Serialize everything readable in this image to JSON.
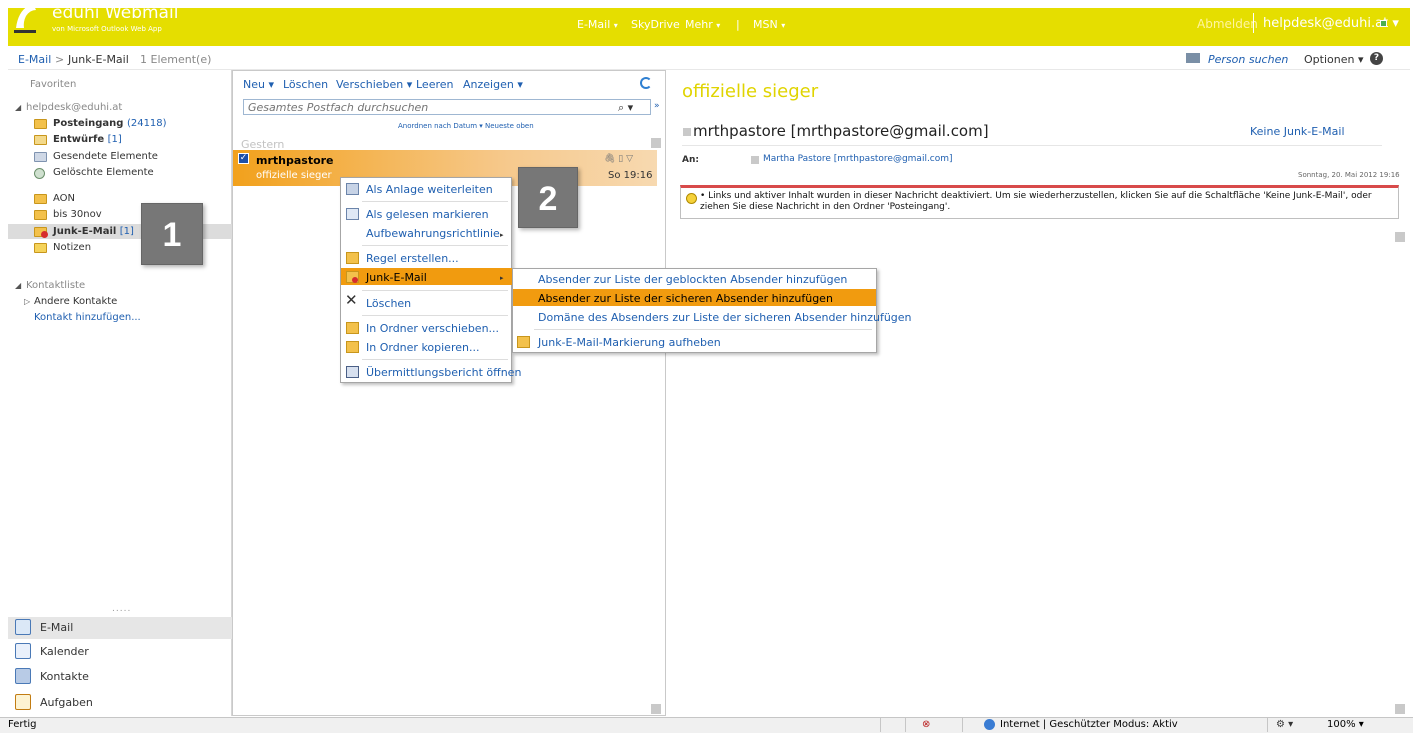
{
  "header": {
    "app_title": "eduhi Webmail",
    "app_subtitle": "von Microsoft Outlook Web App",
    "nav": [
      {
        "label": "E-Mail",
        "caret": "▾"
      },
      {
        "label": "SkyDrive",
        "caret": ""
      },
      {
        "label": "Mehr",
        "caret": "▾"
      },
      {
        "label": "|",
        "caret": ""
      },
      {
        "label": "MSN",
        "caret": "▾"
      }
    ],
    "logout": "Abmelden",
    "user": "helpdesk@eduhi.at ▾"
  },
  "breadcrumb": {
    "mail": "E-Mail",
    "separator": ">",
    "folder": "Junk-E-Mail",
    "count": "1 Element(e)",
    "person_search": "Person suchen",
    "options": "Optionen ▾",
    "help": "?"
  },
  "leftnav": {
    "favorites": "Favoriten",
    "account": "helpdesk@eduhi.at",
    "folders": [
      {
        "label": "Posteingang",
        "count": "(24118)",
        "bold": true
      },
      {
        "label": "Entwürfe",
        "count": "[1]",
        "bold": true
      },
      {
        "label": "Gesendete Elemente",
        "count": "",
        "bold": false
      },
      {
        "label": "Gelöschte Elemente",
        "count": "",
        "bold": false
      }
    ],
    "custom_folders": [
      {
        "label": "AON",
        "count": ""
      },
      {
        "label": "bis 30nov",
        "count": ""
      },
      {
        "label": "Junk-E-Mail",
        "count": "[1]"
      },
      {
        "label": "Notizen",
        "count": ""
      }
    ],
    "contacts_header": "Kontaktliste",
    "other_contacts": "Andere Kontakte",
    "add_contact": "Kontakt hinzufügen...",
    "grip": ".....",
    "modules": [
      {
        "label": "E-Mail",
        "icon": "mail-icon"
      },
      {
        "label": "Kalender",
        "icon": "calendar-icon"
      },
      {
        "label": "Kontakte",
        "icon": "contacts-icon"
      },
      {
        "label": "Aufgaben",
        "icon": "tasks-icon"
      }
    ]
  },
  "list": {
    "toolbar": {
      "new": "Neu ▾",
      "delete": "Löschen",
      "move": "Verschieben ▾",
      "empty": "Leeren",
      "view": "Anzeigen ▾"
    },
    "search_placeholder": "Gesamtes Postfach durchsuchen",
    "sort": "Anordnen nach Datum  ▾   Neueste oben",
    "date_group": "Gestern",
    "message": {
      "sender": "mrthpastore",
      "subject": "offizielle sieger",
      "time": "So 19:16",
      "checked": "✓"
    }
  },
  "reading": {
    "subject": "offizielle sieger",
    "sender": "mrthpastore [mrthpastore@gmail.com]",
    "not_junk": "Keine Junk-E-Mail",
    "to_label": "An:",
    "to_value": "Martha Pastore [mrthpastore@gmail.com]",
    "date": "Sonntag, 20. Mai 2012 19:16",
    "warning": "• Links und aktiver Inhalt wurden in dieser Nachricht deaktiviert. Um sie wiederherzustellen, klicken Sie auf die Schaltfläche 'Keine Junk-E-Mail', oder ziehen Sie diese Nachricht in den Ordner 'Posteingang'."
  },
  "badges": {
    "one": "1",
    "two": "2"
  },
  "context_menu": {
    "forward_attachment": "Als Anlage weiterleiten",
    "mark_read": "Als gelesen markieren",
    "retention": "Aufbewahrungsrichtlinie",
    "create_rule": "Regel erstellen...",
    "junk": "Junk-E-Mail",
    "delete": "Löschen",
    "move_to": "In Ordner verschieben...",
    "copy_to": "In Ordner kopieren...",
    "delivery_report": "Übermittlungsbericht öffnen"
  },
  "submenu": {
    "block_sender": "Absender zur Liste der geblockten Absender hinzufügen",
    "safe_sender": "Absender zur Liste der sicheren Absender hinzufügen",
    "safe_domain": "Domäne des Absenders zur Liste der sicheren Absender hinzufügen",
    "not_junk": "Junk-E-Mail-Markierung aufheben"
  },
  "statusbar": {
    "status": "Fertig",
    "zone": "Internet | Geschützter Modus: Aktiv",
    "zoom": "100%  ▾"
  },
  "colors": {
    "brand": "#e5de00",
    "highlight": "#f19b0f",
    "link": "#1f5fb0"
  }
}
